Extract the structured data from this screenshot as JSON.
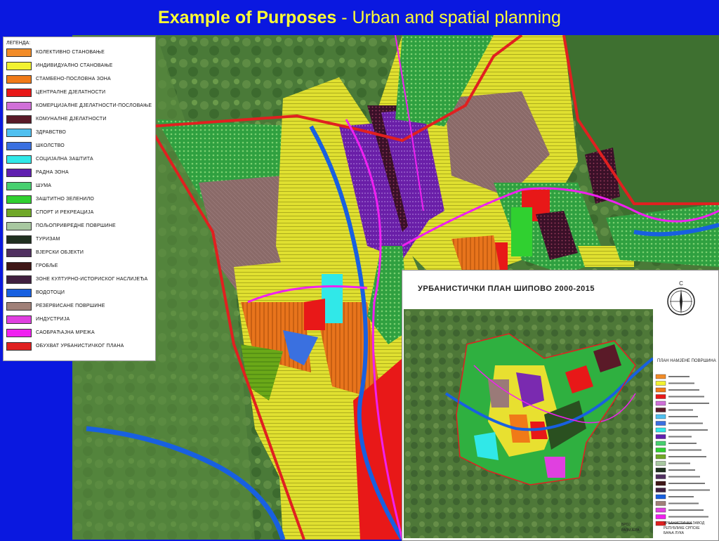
{
  "slide": {
    "title_bold": "Example of Purposes",
    "title_rest": " - Urban and spatial planning"
  },
  "legend": {
    "title": "ЛЕГЕНДА:",
    "items": [
      {
        "label": "КОЛЕКТИВНО  СТАНОВАЊЕ",
        "color": "#f28c28"
      },
      {
        "label": "ИНДИВИДУАЛНО СТАНОВАЊЕ",
        "color": "#f2f230"
      },
      {
        "label": "СТАМБЕНО-ПОСЛОВНА ЗОНА",
        "color": "#f07a18"
      },
      {
        "label": "ЦЕНТРАЛНЕ ДЈЕЛАТНОСТИ",
        "color": "#e81818"
      },
      {
        "label": "КОМЕРЦИЈАЛНЕ ДЈЕЛАТНОСТИ-ПОСЛОВАЊЕ",
        "color": "#d070d8"
      },
      {
        "label": "КОМУНАЛНЕ ДЈЕЛАТНОСТИ",
        "color": "#5a1a28"
      },
      {
        "label": "ЗДРАВСТВО",
        "color": "#50c0f0"
      },
      {
        "label": "ШКОЛСТВО",
        "color": "#3a70e0"
      },
      {
        "label": "СОЦИЈАЛНА ЗАШТИТА",
        "color": "#30e8e8"
      },
      {
        "label": "РАДНА ЗОНА",
        "color": "#6020b0"
      },
      {
        "label": "ШУМА",
        "color": "#48d070"
      },
      {
        "label": "ЗАШТИТНО ЗЕЛЕНИЛО",
        "color": "#30d030"
      },
      {
        "label": "СПОРТ И РЕКРЕАЦИЈА",
        "color": "#70a828"
      },
      {
        "label": "ПОЉОПРИВРЕДНЕ ПОВРШИНЕ",
        "color": "#a8c8a0"
      },
      {
        "label": "ТУРИЗАМ",
        "color": "#203020"
      },
      {
        "label": "ВЈЕРСКИ ОБЈЕКТИ",
        "color": "#503060"
      },
      {
        "label": "ГРОБЉЕ",
        "color": "#401818"
      },
      {
        "label": "ЗОНЕ КУЛТУРНО-ИСТОРИСКОГ НАСЛИЈЕЂА",
        "color": "#402040"
      },
      {
        "label": "ВОДОТОЦИ",
        "color": "#1860e0"
      },
      {
        "label": "РЕЗЕРВИСАНЕ ПОВРШИНЕ",
        "color": "#a08078"
      },
      {
        "label": "ИНДУСТРИЈА",
        "color": "#e040e0"
      },
      {
        "label": "САОБРАЋАЈНА МРЕЖА",
        "color": "#f020f0"
      },
      {
        "label": "ОБУХВАТ УРБАНИСТИЧКОГ ПЛАНА",
        "color": "#e02020"
      }
    ]
  },
  "inset": {
    "title": "УРБАНИСТИЧКИ  ПЛАН  ШИПОВО 2000-2015",
    "compass_letter": "С",
    "plan_label": "ПЛАН НАМЈЕНЕ ПОВРШИНА",
    "footer_left_1": "БРОЈ",
    "footer_left_2": "РАЗМЈЕРА",
    "footer_right_1": "УРБАНИСТИЧКИ ЗАВОД",
    "footer_right_2": "РЕПУБЛИКЕ СРПСКЕ",
    "footer_right_3": "БАЊА ЛУКА"
  },
  "colors": {
    "slide_bg": "#0a18e0",
    "title_text": "#ffff33",
    "boundary": "#e02020",
    "road": "#f020f0",
    "river": "#1860e0"
  }
}
